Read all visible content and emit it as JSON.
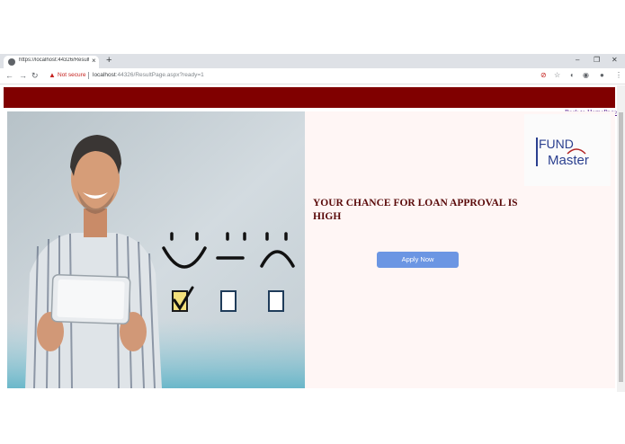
{
  "browser": {
    "tab_title": "https://localhost:44326/ResultP...",
    "tab_close": "×",
    "new_tab": "+",
    "security_label": "Not secure",
    "url_host": "localhost",
    "url_rest": ":44326/ResultPage.aspx?ready=1",
    "window_controls": {
      "minimize": "–",
      "maximize": "❐",
      "close": "✕"
    },
    "nav": {
      "back": "←",
      "forward": "→",
      "reload": "↻"
    }
  },
  "page": {
    "back_link": "Back to HomePage",
    "result_heading": "YOUR CHANCE FOR LOAN APPROVAL IS HIGH",
    "apply_button": "Apply Now",
    "logo": {
      "line1": "FUND",
      "line2": "Master"
    }
  },
  "colors": {
    "banner": "#800000",
    "panel_bg": "#fff6f5",
    "heading": "#5a0a0a",
    "button": "#6b96e3",
    "logo_text": "#2a3f8f",
    "logo_accent": "#b22222"
  }
}
